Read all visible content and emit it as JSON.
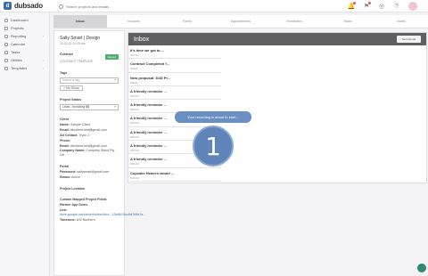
{
  "app": {
    "name": "dubsado",
    "logo_letter": "d"
  },
  "search": {
    "placeholder": "Search projects and emails"
  },
  "top_icons": [
    "bell-icon",
    "flag-icon",
    "check-circle-icon",
    "help-icon"
  ],
  "sidebar": {
    "items": [
      {
        "label": "Dashboard",
        "icon": "dashboard-icon",
        "chevron": false
      },
      {
        "label": "Projects",
        "icon": "folder-icon",
        "chevron": false
      },
      {
        "label": "Reporting",
        "icon": "chart-icon",
        "chevron": true
      },
      {
        "label": "Calendar",
        "icon": "calendar-icon",
        "chevron": false
      },
      {
        "label": "Tasks",
        "icon": "tasks-icon",
        "chevron": false
      },
      {
        "label": "Utilities",
        "icon": "wrench-icon",
        "chevron": true
      },
      {
        "label": "Templates",
        "icon": "template-icon",
        "chevron": true
      }
    ]
  },
  "tabs": [
    {
      "label": "Inbox",
      "active": true
    },
    {
      "label": "Invoices",
      "active": false
    },
    {
      "label": "Forms",
      "active": false
    },
    {
      "label": "Appointments",
      "active": false
    },
    {
      "label": "Reminders",
      "active": false
    },
    {
      "label": "Tasks",
      "active": false
    },
    {
      "label": "Notes",
      "active": false
    }
  ],
  "details": {
    "title": "Sally Smart | Design",
    "subtitle": "10-22-22 10:25 am",
    "contract_label": "Contract",
    "contract_badge": "Signed",
    "contract_template": "CONTRACT TEMPLATE",
    "tags_label": "Tags",
    "tags_placeholder": "Select a tag",
    "tag_chip": "No Show",
    "project_status_label": "Project Status",
    "lead_status": "Lead : Invoicing $$",
    "client_label": "Client",
    "client_rows": [
      {
        "k": "Name:",
        "v": "Sample Client"
      },
      {
        "k": "Email:",
        "v": "dbcclient.test@gmail.com"
      },
      {
        "k": "Alt Contact:",
        "v": "Tryon 2"
      },
      {
        "k": "Phone:",
        "v": ""
      },
      {
        "k": "Email:",
        "v": "dbcclient.test@gmail.com"
      },
      {
        "k": "Company Name:",
        "v": "Company Stand Pty Ltd"
      }
    ],
    "portal_label": "Portal",
    "portal_rows": [
      {
        "k": "Password:",
        "v": "sallysmart@gmail.com"
      },
      {
        "k": "Status:",
        "v": "Active"
      }
    ],
    "location_label": "Project Location",
    "mapped_label": "Custom Mapped Project Fields",
    "partner_label": "Partner App Demo",
    "link_label": "Link:",
    "link_value": "drive.google.com/drive/folders/thcx...12fe8b76cc6d7d5b7a...",
    "timezone_label": "Timezone:",
    "timezone_value": "US/ Northern"
  },
  "inbox": {
    "title": "Inbox",
    "send_button": "Send Email",
    "messages": [
      {
        "subject": "It's time we got to ...",
        "date": "10/7/21"
      },
      {
        "subject": "Contract Completed f...",
        "date": "9/8/22"
      },
      {
        "subject": "New proposal: D4D Pr...",
        "date": "9/8/22"
      },
      {
        "subject": "A friendly reminder ...",
        "date": "8/26/22"
      },
      {
        "subject": "A friendly reminder ...",
        "date": "8/26/22"
      },
      {
        "subject": "A friendly reminder ...",
        "date": "8/26/22"
      },
      {
        "subject": "A friendly reminder ...",
        "date": "8/26/22"
      },
      {
        "subject": "A friendly reminder ...",
        "date": "8/26/22"
      },
      {
        "subject": "A friendly reminder ...",
        "date": "8/26/22"
      },
      {
        "subject": "Cupcake Heaven would ...",
        "date": "8/26/22"
      }
    ]
  },
  "recording": {
    "tooltip": "Your recording is about to start...",
    "countdown": "1"
  },
  "colors": {
    "accent": "#3a6ea5",
    "inbox_header": "#5f5f62",
    "overlay_blue": "#5f84ba",
    "signed_green": "#4caf6a",
    "help_green": "#2e8a6c"
  }
}
